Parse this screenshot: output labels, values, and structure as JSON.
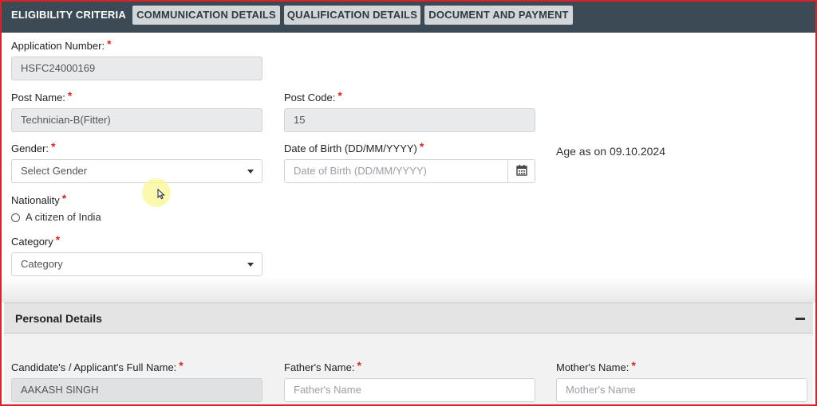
{
  "tabs": [
    {
      "label": "ELIGIBILITY CRITERIA",
      "active": true
    },
    {
      "label": "COMMUNICATION DETAILS",
      "active": false
    },
    {
      "label": "QUALIFICATION DETAILS",
      "active": false
    },
    {
      "label": "DOCUMENT AND PAYMENT",
      "active": false
    }
  ],
  "form": {
    "application_number": {
      "label": "Application Number:",
      "value": "HSFC24000169"
    },
    "post_name": {
      "label": "Post Name:",
      "value": "Technician-B(Fitter)"
    },
    "post_code": {
      "label": "Post Code:",
      "value": "15"
    },
    "gender": {
      "label": "Gender:",
      "selected": "Select Gender"
    },
    "dob": {
      "label": "Date of Birth (DD/MM/YYYY)",
      "placeholder": "Date of Birth (DD/MM/YYYY)"
    },
    "age_note": "Age as on 09.10.2024",
    "nationality": {
      "label": "Nationality",
      "option": "A citizen of India"
    },
    "category": {
      "label": "Category",
      "selected": "Category"
    },
    "required_mark": "*"
  },
  "personal_details": {
    "title": "Personal Details",
    "collapse_icon": "minus-icon",
    "full_name": {
      "label": "Candidate's / Applicant's Full Name:",
      "value": "AAKASH SINGH"
    },
    "father_name": {
      "label": "Father's Name:",
      "placeholder": "Father's Name"
    },
    "mother_name": {
      "label": "Mother's Name:",
      "placeholder": "Mother's Name"
    }
  },
  "colors": {
    "tabbar": "#3b4a55",
    "border": "#d9232a",
    "required": "#d42a2a"
  }
}
